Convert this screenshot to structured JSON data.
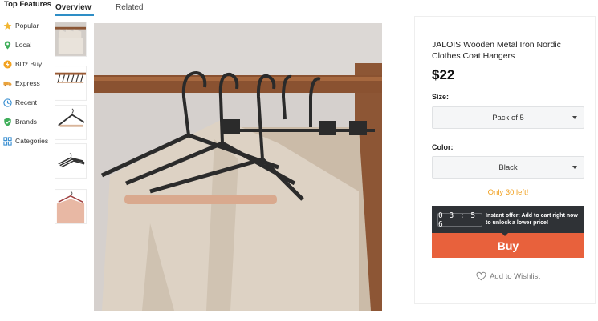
{
  "sidebar": {
    "title": "Top Features",
    "items": [
      {
        "label": "Popular",
        "icon": "star-icon",
        "color": "#f2b632"
      },
      {
        "label": "Local",
        "icon": "map-pin-icon",
        "color": "#3fae5a"
      },
      {
        "label": "Blitz Buy",
        "icon": "lightning-icon",
        "color": "#f2a21f"
      },
      {
        "label": "Express",
        "icon": "truck-icon",
        "color": "#e9a23b"
      },
      {
        "label": "Recent",
        "icon": "clock-icon",
        "color": "#3a8fd1"
      },
      {
        "label": "Brands",
        "icon": "shield-check-icon",
        "color": "#3fae5a"
      },
      {
        "label": "Categories",
        "icon": "grid-icon",
        "color": "#3a8fd1"
      }
    ]
  },
  "tabs": [
    {
      "label": "Overview",
      "active": true
    },
    {
      "label": "Related",
      "active": false
    }
  ],
  "product": {
    "title": "JALOIS Wooden Metal Iron Nordic Clothes Coat Hangers",
    "price": "$22",
    "size_label": "Size:",
    "size_value": "Pack of 5",
    "color_label": "Color:",
    "color_value": "Black",
    "stock": "Only 30 left!",
    "timer": "03:56",
    "offer": "Instant offer: Add to cart right now to unlock a lower price!",
    "buy_label": "Buy",
    "wishlist_label": "Add to Wishlist"
  },
  "colors": {
    "accent": "#2e8ec6",
    "buy": "#e8613c",
    "stock": "#f0a020",
    "offer_bg": "#2f3236"
  }
}
